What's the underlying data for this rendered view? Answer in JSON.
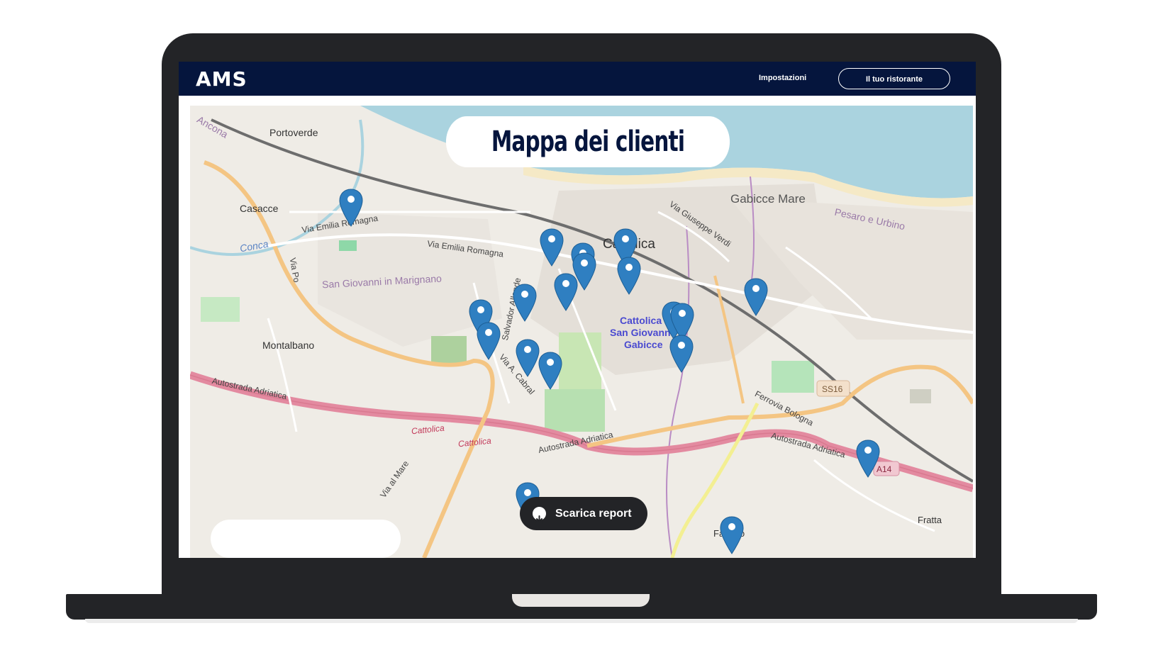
{
  "app": {
    "logo": "AMS"
  },
  "nav": {
    "settings_label": "Impostazioni",
    "restaurant_label": "Il tuo ristorante"
  },
  "map": {
    "title": "Mappa dei clienti",
    "download_label": "Scarica report",
    "places": [
      "Portoverde",
      "Casacce",
      "Montalbano",
      "Cattolica",
      "Gabicce Mare",
      "Fanano",
      "Fratta"
    ],
    "area_label": [
      "Cattolica",
      "San Giovanni",
      "Gabicce"
    ],
    "streets": [
      "Via Emilia Romagna",
      "Via Emilia Romagna",
      "San Giovanni in Marignano",
      "Autostrada Adriatica",
      "Autostrada Adriatica",
      "Autostrada Adriatica",
      "Via Giuseppe Verdi",
      "Ferrovia Bologna",
      "Via A. Cabral",
      "Via al Mare",
      "Via Po",
      "Pesaro e Urbino",
      "Conca",
      "Cattolica",
      "Cattolica",
      "SS16",
      "A14",
      "Ancona",
      "Salvador Allende"
    ],
    "pin_color": "#2f7fc1",
    "markers_count": 19
  }
}
